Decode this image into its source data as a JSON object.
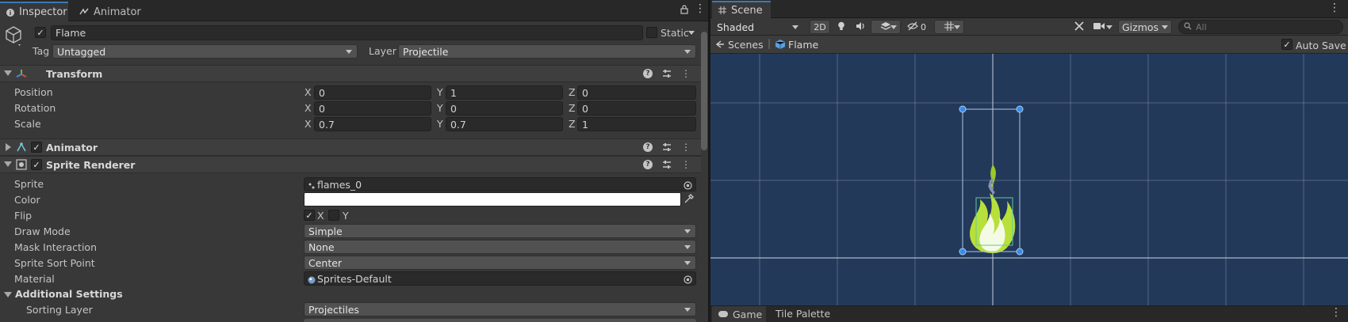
{
  "inspector": {
    "tabs": [
      {
        "label": "Inspector",
        "icon": "info-icon"
      },
      {
        "label": "Animator",
        "icon": "animator-icon"
      }
    ],
    "object": {
      "name": "Flame",
      "active": true,
      "static_label": "Static",
      "tag_label": "Tag",
      "tag_value": "Untagged",
      "layer_label": "Layer",
      "layer_value": "Projectile"
    },
    "transform": {
      "title": "Transform",
      "rows": [
        {
          "label": "Position",
          "x": "0",
          "y": "1",
          "z": "0"
        },
        {
          "label": "Rotation",
          "x": "0",
          "y": "0",
          "z": "0"
        },
        {
          "label": "Scale",
          "x": "0.7",
          "y": "0.7",
          "z": "1"
        }
      ]
    },
    "animator": {
      "title": "Animator",
      "enabled": true
    },
    "sprite_renderer": {
      "title": "Sprite Renderer",
      "enabled": true,
      "sprite_label": "Sprite",
      "sprite_value": "flames_0",
      "color_label": "Color",
      "color_value": "#FFFFFF",
      "flip_label": "Flip",
      "flip_x": "X",
      "flip_y": "Y",
      "draw_mode_label": "Draw Mode",
      "draw_mode_value": "Simple",
      "mask_label": "Mask Interaction",
      "mask_value": "None",
      "sort_point_label": "Sprite Sort Point",
      "sort_point_value": "Center",
      "material_label": "Material",
      "material_value": "Sprites-Default",
      "additional_title": "Additional Settings",
      "sorting_layer_label": "Sorting Layer",
      "sorting_layer_value": "Projectiles"
    }
  },
  "scene": {
    "tab_label": "Scene",
    "shading": "Shaded",
    "mode_2d": "2D",
    "hidden_count": "0",
    "gizmos_label": "Gizmos",
    "search_placeholder": "All",
    "breadcrumb_root": "Scenes",
    "breadcrumb_current": "Flame",
    "auto_save_label": "Auto Save",
    "auto_save_checked": true,
    "bottom_tabs": [
      "Game",
      "Tile Palette"
    ]
  },
  "colors": {
    "accent": "#3a79bb",
    "scene_bg": "#23395a",
    "flame": "#b8e03a"
  }
}
